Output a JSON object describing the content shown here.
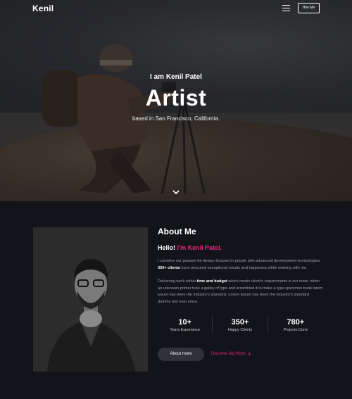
{
  "header": {
    "logo": "Kenil",
    "hire_label": "Hire Me"
  },
  "hero": {
    "intro": "I am Kenil Patel",
    "title": "Artist",
    "subtitle": "based in San Francisco, California."
  },
  "about": {
    "title": "About Me",
    "hello_prefix": "Hello! ",
    "hello_name": "I'm Kenil Patel.",
    "para1_a": "I combine our passion for design focused in people with advanced development technologies. ",
    "para1_b": "350+ clients",
    "para1_c": " have procured exceptional results and happiness while working with me.",
    "para2_a": "Delivering work within ",
    "para2_b": "time and budget",
    "para2_c": " which meets client's requirements is our moto. when an unknown printer took a galley of type and scrambled it to make a type specimen book lorem ipsum has been the industry's standard. Lorem Ipsum has been the industry's standard dummy text ever since.",
    "stats": [
      {
        "value": "10+",
        "label": "Years Experiance"
      },
      {
        "value": "350+",
        "label": "Happy Clients"
      },
      {
        "value": "780+",
        "label": "Projects Done"
      }
    ],
    "about_btn": "About more",
    "discover_link": "Discover My Work"
  },
  "colors": {
    "accent": "#e6257a",
    "background": "#121419"
  }
}
